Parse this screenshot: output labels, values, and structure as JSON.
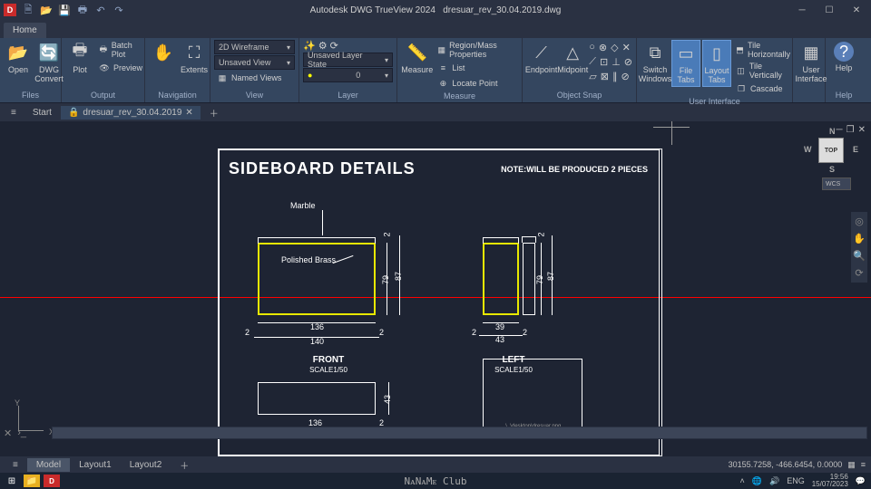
{
  "title": {
    "app": "Autodesk DWG TrueView 2024",
    "file": "dresuar_rev_30.04.2019.dwg"
  },
  "maintab": "Home",
  "ribbon": {
    "files": {
      "label": "Files",
      "open": "Open",
      "convert": "DWG\nConvert"
    },
    "output": {
      "label": "Output",
      "plot": "Plot",
      "batch": "Batch Plot",
      "preview": "Preview"
    },
    "navigation": {
      "label": "Navigation",
      "extents": "Extents"
    },
    "view": {
      "label": "View",
      "style": "2D Wireframe",
      "savedview": "Unsaved View",
      "named": "Named Views"
    },
    "layer": {
      "label": "Layer",
      "state": "Unsaved Layer State",
      "current": "0"
    },
    "measure": {
      "label": "Measure",
      "btn": "Measure",
      "region": "Region/Mass Properties",
      "list": "List",
      "locate": "Locate Point"
    },
    "osnap": {
      "label": "Object Snap",
      "endpoint": "Endpoint",
      "midpoint": "Midpoint"
    },
    "ui": {
      "label": "User Interface",
      "switch": "Switch\nWindows",
      "filetabs": "File Tabs",
      "layouttabs": "Layout\nTabs",
      "th": "Tile Horizontally",
      "tv": "Tile Vertically",
      "cascade": "Cascade",
      "uipanel": "User\nInterface"
    },
    "help": {
      "label": "Help",
      "btn": "Help"
    }
  },
  "filetabs": {
    "start": "Start",
    "file": "dresuar_rev_30.04.2019"
  },
  "drawing": {
    "title": "SIDEBOARD  DETAILS",
    "note": "NOTE:WILL BE PRODUCED 2 PIECES",
    "marble": "Marble",
    "brass": "Polished Brass",
    "front": "FRONT",
    "left": "LEFT",
    "scale": "SCALE1/50",
    "d136": "136",
    "d140": "140",
    "d2": "2",
    "d79": "79",
    "d87": "87",
    "d39": "39",
    "d43": "43",
    "d43b": "43",
    "d136b": "136"
  },
  "ucs": {
    "x": "X",
    "y": "Y"
  },
  "viewcube": {
    "top": "TOP",
    "n": "N",
    "s": "S",
    "e": "E",
    "w": "W",
    "wcs": "WCS"
  },
  "layouts": {
    "model": "Model",
    "l1": "Layout1",
    "l2": "Layout2"
  },
  "status": {
    "coords": "30155.7258, -466.6454, 0.0000"
  },
  "taskbar": {
    "brand": "NᴀNᴀMᴇ Club",
    "lang": "ENG",
    "time": "19:56",
    "date": "15/07/2023"
  }
}
